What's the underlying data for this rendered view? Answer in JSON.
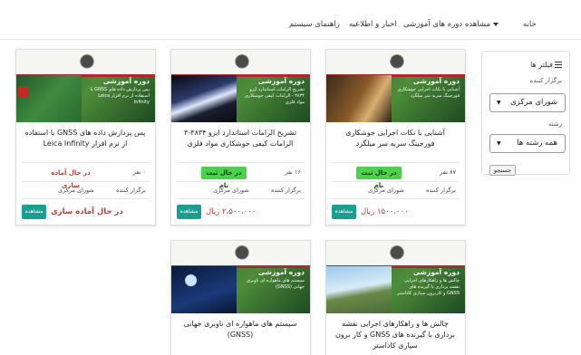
{
  "nav": {
    "home": "خانه",
    "courses": "مشاهده دوره های آموزشی",
    "news": "اخبار و اطلاعیه",
    "help": "راهنمای سیستم"
  },
  "filters": {
    "title": "فیلتر ها",
    "organizer_label": "برگزار کننده",
    "organizer_value": "شورای مرکزی",
    "field_label": "رشته",
    "field_value": "همه رشته ها",
    "search_label": "جستجو"
  },
  "labels": {
    "organizer": "برگزار کننده",
    "view": "مشاهده",
    "banner_heading": "دوره آموزشی"
  },
  "cards": [
    {
      "title": "آشنایی با نکات اجرایی جوشکاری فورجینگ سربه سر میلگرد",
      "banner_sub": "آشنایی با نکات اجرایی جوشکاری فورجینگ سربه سر میلگرد",
      "capacity": "۸۷ نفر",
      "status": "در حال ثبت نام",
      "organizer": "شورای مرکزی",
      "price": "۱۵۰۰،۰۰۰ ریال"
    },
    {
      "title": "تشریح الزامات استاندارد ایزو ۳۸۳۴-۳ الزامات کیفی جوشکاری مواد فلزی",
      "banner_sub": "تشریح الزامات استاندارد ایزو ۳۸۳۴ - الزامات کیفی جوشکاری مواد فلزی",
      "capacity": "۱۶ نفر",
      "status": "در حال ثبت نام",
      "organizer": "شورای مرکزی",
      "price": "۲،۵۰۰،۰۰۰ ریال"
    },
    {
      "title": "پس پردازش داده های GNSS با استفاده از نرم افزار Leica Infinity",
      "banner_sub": "پس پردازش داده های GNSS با استفاده از نرم افزار Leica Infinity",
      "capacity": "۰ نفر",
      "status": "در حال آماده سازی",
      "organizer": "شورای مرکزی",
      "price": "در حال آماده سازی"
    },
    {
      "title": "چالش ها و راهکارهای اجرایی نقشه برداری با گیرنده های GNSS و کار برون سپاری کاداستر",
      "banner_sub": "چالش ها و راهکارهای اجرایی نقشه برداری با گیرنده های GNSS و کاربرون سپاری کاداستر"
    },
    {
      "title": "سیستم های ماهواره ای ناوبری جهانی (GNSS)",
      "banner_sub": "سیستم های ماهواره ای ناوبری جهانی (GNSS)"
    }
  ]
}
